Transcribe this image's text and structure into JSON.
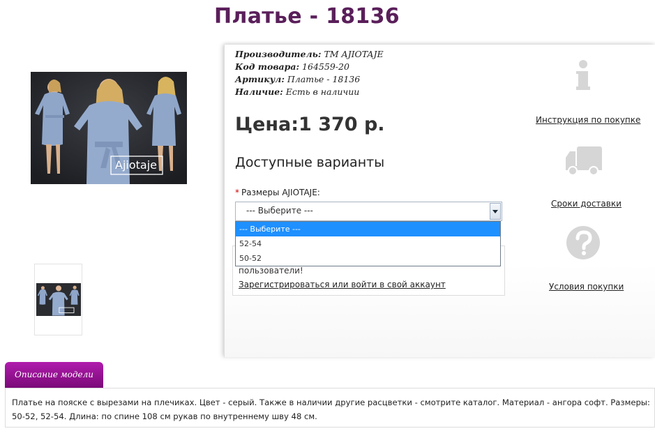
{
  "product": {
    "title": "Платье - 18136",
    "manufacturer_label": "Производитель:",
    "manufacturer_value": " ТМ AJIOTAJE",
    "code_label": "Код товара:",
    "code_value": " 164559-20",
    "article_label": "Артикул:",
    "article_value": " Платье - 18136",
    "stock_label": "Наличие:",
    "stock_value": " Есть в наличии",
    "price": "Цена:1 370 р.",
    "brand_watermark": "Ajiotaje"
  },
  "variants": {
    "title": "Доступные варианты",
    "required_mark": "*",
    "size_label": "Размеры AJIOTAJE:",
    "selected_value": "--- Выберите ---",
    "options": [
      "--- Выберите ---",
      "52-54",
      "50-52"
    ]
  },
  "login": {
    "text_partial": "пользователи!",
    "link": "Зарегистрироваться или войти в свой аккаунт"
  },
  "sidebar": {
    "instruction_icon": "info-icon",
    "instruction_link": "Инструкция по покупке",
    "delivery_icon": "truck-icon",
    "delivery_link": "Сроки доставки",
    "terms_icon": "question-icon",
    "terms_link": "Условия покупки"
  },
  "description": {
    "tab_label": "Описание модели",
    "text": "Платье на пояске с вырезами на плечиках. Цвет - серый. Также в наличии другие расцветки - смотрите каталог. Материал - ангора софт. Размеры: 50-52, 52-54. Длина: по спине 108 см рукав по внутреннему шву 48 см."
  },
  "colors": {
    "title": "#5a1f5a",
    "tab_gradient_top": "#b01cad",
    "tab_gradient_bottom": "#7a0a78",
    "dropdown_highlight": "#1e90ff",
    "icon_gray": "#d6d6d6",
    "dress_blue": "#8fa6c9"
  }
}
